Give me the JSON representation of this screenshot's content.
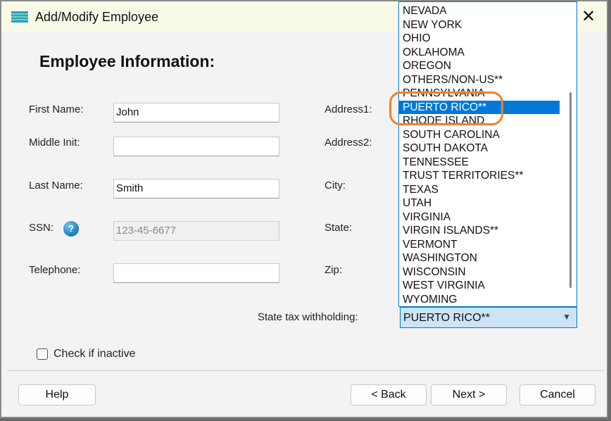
{
  "window": {
    "title": "Add/Modify Employee"
  },
  "heading": "Employee Information:",
  "fields": {
    "first_name": {
      "label": "First Name:",
      "value": "John"
    },
    "middle_init": {
      "label": "Middle Init:",
      "value": ""
    },
    "last_name": {
      "label": "Last Name:",
      "value": "Smith"
    },
    "ssn": {
      "label": "SSN:",
      "value": "123-45-6677"
    },
    "telephone": {
      "label": "Telephone:",
      "value": ""
    },
    "address1": {
      "label": "Address1:"
    },
    "address2": {
      "label": "Address2:"
    },
    "city": {
      "label": "City:"
    },
    "state": {
      "label": "State:"
    },
    "zip": {
      "label": "Zip:"
    }
  },
  "state_tax": {
    "label": "State tax withholding:",
    "selected": "PUERTO RICO**",
    "options": [
      "NEVADA",
      "NEW YORK",
      "OHIO",
      "OKLAHOMA",
      "OREGON",
      "OTHERS/NON-US**",
      "PENNSYLVANIA",
      "PUERTO RICO**",
      "RHODE ISLAND",
      "SOUTH CAROLINA",
      "SOUTH DAKOTA",
      "TENNESSEE",
      "TRUST TERRITORIES**",
      "TEXAS",
      "UTAH",
      "VIRGINIA",
      "VIRGIN ISLANDS**",
      "VERMONT",
      "WASHINGTON",
      "WISCONSIN",
      "WEST VIRGINIA",
      "WYOMING"
    ]
  },
  "inactive_label": "Check if inactive",
  "buttons": {
    "help": "Help",
    "back": "< Back",
    "next": "Next >",
    "cancel": "Cancel"
  },
  "colors": {
    "accent": "#0078d7",
    "highlight_ring": "#f0812d",
    "titlebar": "#f9f9e8"
  }
}
